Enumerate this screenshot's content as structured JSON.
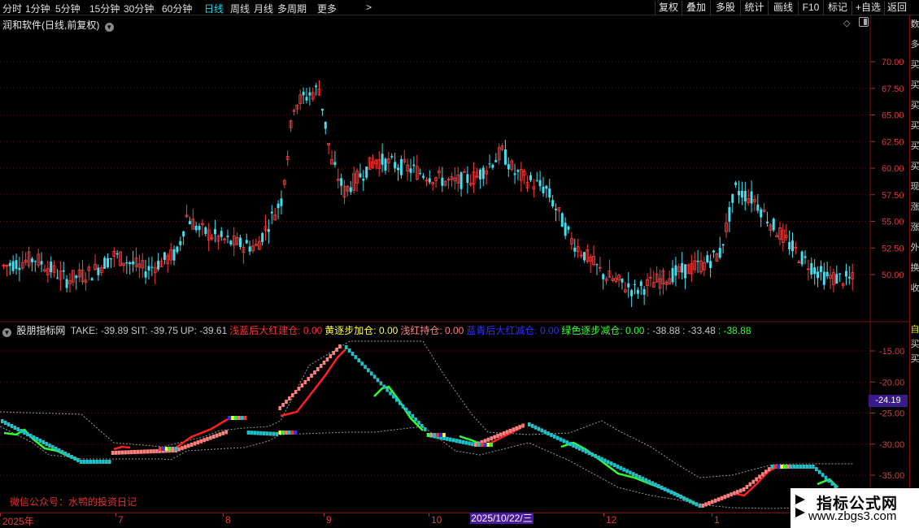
{
  "toolbar": {
    "periods": [
      {
        "label": "分时",
        "active": false
      },
      {
        "label": "1分钟",
        "active": false
      },
      {
        "label": "5分钟",
        "active": false
      },
      {
        "label": "15分钟",
        "active": false
      },
      {
        "label": "30分钟",
        "active": false
      },
      {
        "label": "60分钟",
        "active": false
      },
      {
        "label": "日线",
        "active": true
      },
      {
        "label": "周线",
        "active": false
      },
      {
        "label": "月线",
        "active": false
      },
      {
        "label": "多周期",
        "active": false
      },
      {
        "label": "更多",
        "active": false
      }
    ],
    "more_arrow": ">",
    "buttons": [
      "复权",
      "叠加",
      "多股",
      "统计",
      "画线",
      "F10",
      "标记",
      "+自选",
      "返回"
    ]
  },
  "main_chart": {
    "title": "润和软件(日线,前复权)",
    "price_labels": [
      "70.00",
      "67.50",
      "65.00",
      "62.50",
      "60.00",
      "57.50",
      "55.00",
      "52.50",
      "50.00"
    ],
    "colors": {
      "up": "#ff3b3b",
      "down": "#40e0f0",
      "grid": "#5a1010"
    }
  },
  "right_strip_chars": [
    "数",
    "多",
    "买",
    "买",
    "买",
    "买",
    "买",
    "买",
    "现",
    "涨",
    "涨",
    "外",
    "换",
    "收"
  ],
  "indicator": {
    "name": "股朋指标网",
    "values": [
      {
        "text": "TAKE: -39.89",
        "color": "#c8c8c8"
      },
      {
        "text": "SIT: -39.75",
        "color": "#c8c8c8"
      },
      {
        "text": "UP: -39.61",
        "color": "#c8c8c8"
      },
      {
        "text": "浅蓝后大红建仓: 0.00",
        "color": "#ff3030"
      },
      {
        "text": "黄逐步加仓: 0.00",
        "color": "#ffff30"
      },
      {
        "text": "浅红持仓: 0.00",
        "color": "#ff8080"
      },
      {
        "text": "蓝青后大红减仓: 0.00",
        "color": "#3030ff"
      },
      {
        "text": "绿色逐步减仓: 0.00",
        "color": "#30ff30"
      },
      {
        "text": ": -38.88",
        "color": "#c8c8c8"
      },
      {
        "text": ": -33.48",
        "color": "#c8c8c8"
      },
      {
        "text": ": -38.88",
        "color": "#30ff30"
      }
    ],
    "axis_labels": [
      "-15.00",
      "-20.00",
      "-25.00",
      "-30.00",
      "-35.00"
    ],
    "cursor_value": "-24.19",
    "wechat_note": "微信公众号：水鸭的投资日记",
    "strip_chars": [
      "自",
      "买",
      "买"
    ]
  },
  "x_axis": {
    "labels": [
      "2025年",
      "7",
      "8",
      "9",
      "10",
      "12",
      "1"
    ],
    "cursor_date": "2025/10/22/三"
  },
  "watermark": {
    "title": "指标公式网",
    "url": "www.zbgs3.com"
  }
}
